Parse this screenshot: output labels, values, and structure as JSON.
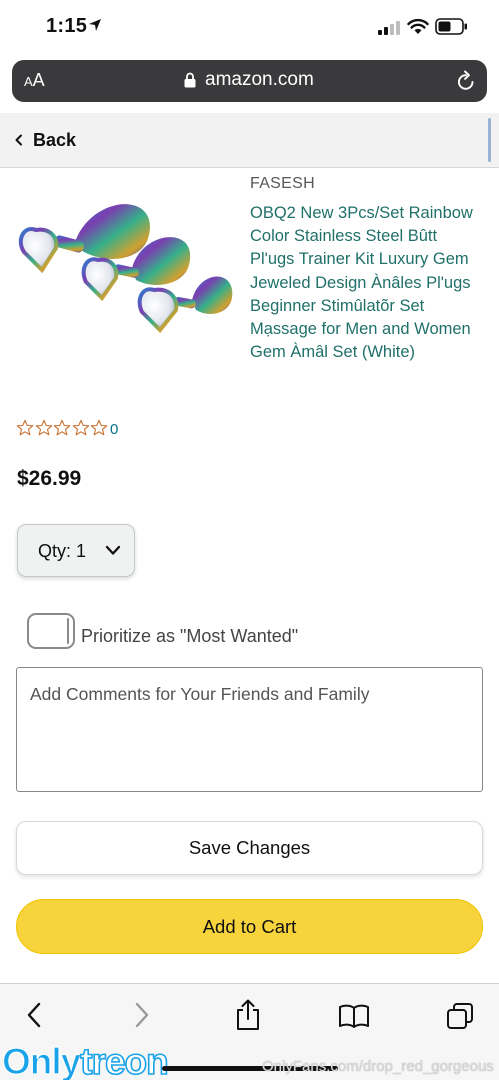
{
  "status_bar": {
    "time": "1:15"
  },
  "url_bar": {
    "text_size_label_small": "A",
    "text_size_label_large": "A",
    "domain": "amazon.com"
  },
  "nav": {
    "back_label": "Back"
  },
  "product": {
    "brand": "FASESH",
    "title": "OBQ2 New 3Pcs/Set Rainbow Color Stainless Steel Bûtt Pl'ugs Trainer Kit Luxury Gem Jeweled Design Ànâles Pl'ugs Beginner Stimûlatõr Set Mạssage for Men and Women Gem Àmâl Set (White)",
    "rating_stars": 0,
    "rating_max": 5,
    "rating_count": "0",
    "price": "$26.99"
  },
  "quantity": {
    "label": "Qty:",
    "value": "1"
  },
  "priority": {
    "label": "Prioritize as \"Most Wanted\"",
    "enabled": false
  },
  "comments": {
    "placeholder": "Add Comments for Your Friends and Family",
    "value": ""
  },
  "actions": {
    "save_label": "Save Changes",
    "add_to_cart_label": "Add to Cart"
  },
  "toolbar": {
    "icons": [
      "back-icon",
      "forward-icon",
      "share-icon",
      "bookmarks-icon",
      "tabs-icon"
    ]
  },
  "watermark": {
    "logo_part1": "Only",
    "logo_part2": "treon",
    "text": "OnlyFans.com/drop_red_gorgeous"
  },
  "colors": {
    "link_teal": "#20706a",
    "cart_yellow": "#f7d33c",
    "star_outline": "#c7702e",
    "url_bar_bg": "#3a3a3c"
  }
}
